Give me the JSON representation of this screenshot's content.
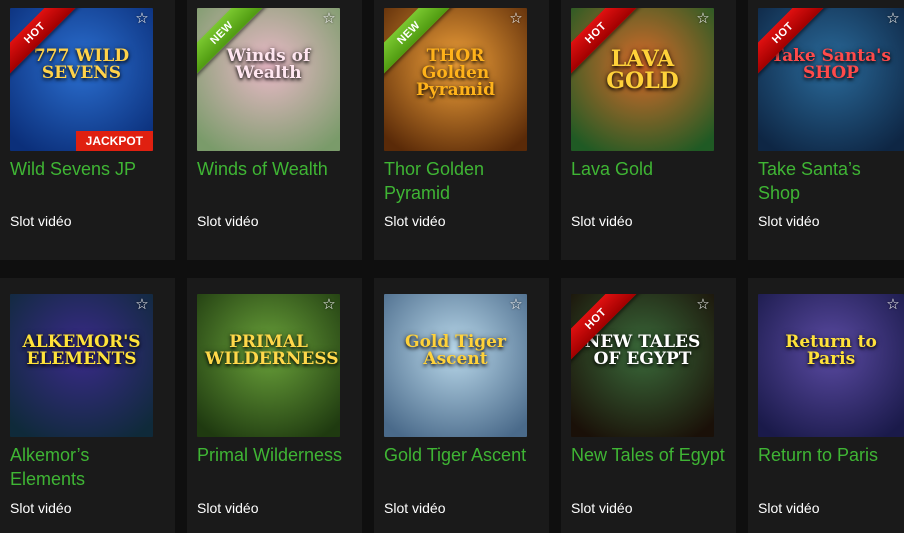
{
  "games": [
    {
      "name": "Wild Sevens JP",
      "type": "Slot vidéo",
      "badge": "HOT",
      "art_title": "777 WILD SEVENS",
      "extra": "JACKPOT",
      "colors": [
        "#2b6fd0",
        "#0b2f7a"
      ],
      "title_color": "#ffd24a"
    },
    {
      "name": "Winds of Wealth",
      "type": "Slot vidéo",
      "badge": "NEW",
      "art_title": "Winds of Wealth",
      "extra": "",
      "colors": [
        "#e9b9c7",
        "#7a9b6a"
      ],
      "title_color": "#ffe6f0"
    },
    {
      "name": "Thor Golden Pyramid",
      "type": "Slot vidéo",
      "badge": "NEW",
      "art_title": "THOR Golden Pyramid",
      "extra": "",
      "colors": [
        "#f2a23a",
        "#5a2a08"
      ],
      "title_color": "#ffb21a"
    },
    {
      "name": "Lava Gold",
      "type": "Slot vidéo",
      "badge": "HOT",
      "art_title": "LAVA GOLD",
      "extra": "",
      "colors": [
        "#d86a2a",
        "#1f5a24"
      ],
      "title_color": "#ffd23a"
    },
    {
      "name": "Take Santa’s Shop",
      "type": "Slot vidéo",
      "badge": "HOT",
      "art_title": "Take Santa's SHOP",
      "extra": "",
      "colors": [
        "#2a6a9a",
        "#0e2644"
      ],
      "title_color": "#ff4a4a"
    },
    {
      "name": "Alkemor’s Elements",
      "type": "Slot vidéo",
      "badge": "",
      "art_title": "ALKEMOR'S ELEMENTS",
      "extra": "",
      "colors": [
        "#3a2a8a",
        "#0f2a3a"
      ],
      "title_color": "#ffe23a"
    },
    {
      "name": "Primal Wilderness",
      "type": "Slot vidéo",
      "badge": "",
      "art_title": "PRIMAL WILDERNESS",
      "extra": "",
      "colors": [
        "#6aa23a",
        "#1f3a10"
      ],
      "title_color": "#ffd84a"
    },
    {
      "name": "Gold Tiger Ascent",
      "type": "Slot vidéo",
      "badge": "",
      "art_title": "Gold Tiger Ascent",
      "extra": "",
      "colors": [
        "#b9d8ea",
        "#4a6a8a"
      ],
      "title_color": "#ffd23a"
    },
    {
      "name": "New Tales of Egypt",
      "type": "Slot vidéo",
      "badge": "HOT",
      "art_title": "NEW TALES OF EGYPT",
      "extra": "",
      "colors": [
        "#3a6a3a",
        "#1a1008"
      ],
      "title_color": "#ffffff"
    },
    {
      "name": "Return to Paris",
      "type": "Slot vidéo",
      "badge": "",
      "art_title": "Return to Paris",
      "extra": "",
      "colors": [
        "#5a4aa2",
        "#1a1a4a"
      ],
      "title_color": "#ffe23a"
    }
  ],
  "icons": {
    "favorite": "star-outline-icon"
  }
}
